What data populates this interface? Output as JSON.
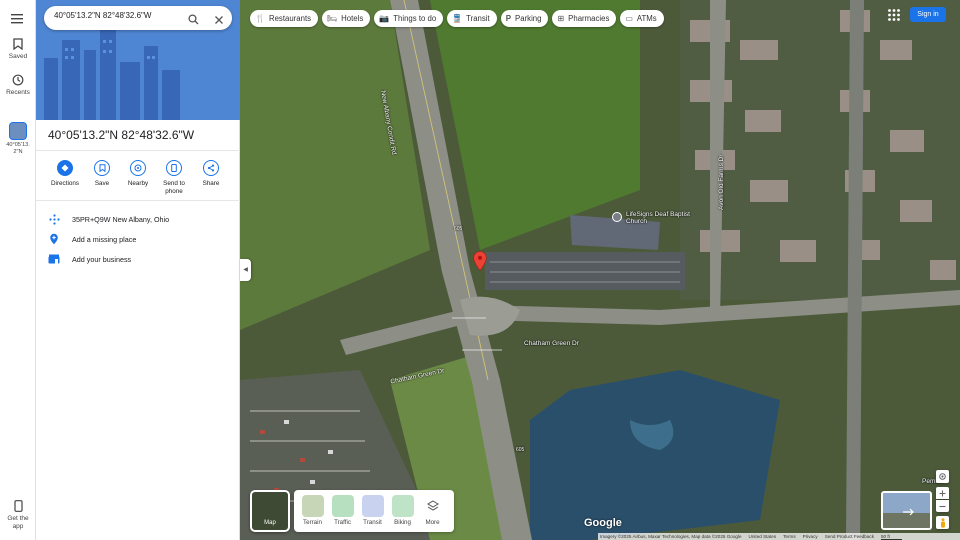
{
  "search": {
    "value": "40°05'13.2\"N 82°48'32.6\"W"
  },
  "rail": {
    "saved": "Saved",
    "recents": "Recents",
    "recent_item": "40°05'13.2\"N",
    "get_app": "Get the app"
  },
  "place": {
    "title": "40°05'13.2\"N 82°48'32.6\"W"
  },
  "actions": [
    {
      "label": "Directions",
      "icon": "directions-icon"
    },
    {
      "label": "Save",
      "icon": "bookmark-icon"
    },
    {
      "label": "Nearby",
      "icon": "nearby-icon"
    },
    {
      "label": "Send to phone",
      "icon": "send-to-phone-icon"
    },
    {
      "label": "Share",
      "icon": "share-icon"
    }
  ],
  "info": {
    "plus_code": "35PR+Q9W New Albany, Ohio",
    "add_place": "Add a missing place",
    "add_business": "Add your business"
  },
  "chips": [
    {
      "label": "Restaurants",
      "icon": "restaurant-icon"
    },
    {
      "label": "Hotels",
      "icon": "hotel-icon"
    },
    {
      "label": "Things to do",
      "icon": "camera-icon"
    },
    {
      "label": "Transit",
      "icon": "transit-icon"
    },
    {
      "label": "Parking",
      "icon": "parking-icon"
    },
    {
      "label": "Pharmacies",
      "icon": "pharmacy-icon"
    },
    {
      "label": "ATMs",
      "icon": "atm-icon"
    }
  ],
  "header": {
    "signin": "Sign in"
  },
  "layers": {
    "main": "Map",
    "options": [
      "Terrain",
      "Traffic",
      "Transit",
      "Biking",
      "More"
    ]
  },
  "map_labels": {
    "road_north": "New Albany Condit Rd",
    "road_east": "Avon Old Farms Dr",
    "church": "LifeSigns Deaf Baptist Church",
    "chatham_west": "Chatham Green Dr",
    "chatham_east": "Chatham Green Dr",
    "pember": "Pember",
    "route_605_a": "605",
    "route_605_b": "605",
    "route_605_c": "605"
  },
  "footer": {
    "imagery": "Imagery ©2025 Airbus, Maxar Technologies, Map data ©2025 Google",
    "country": "United States",
    "terms": "Terms",
    "privacy": "Privacy",
    "feedback": "Send Product Feedback",
    "scale": "50 ft"
  },
  "brand": {
    "logo": "Google"
  },
  "colors": {
    "accent": "#1a73e8",
    "pin": "#ea4335"
  }
}
